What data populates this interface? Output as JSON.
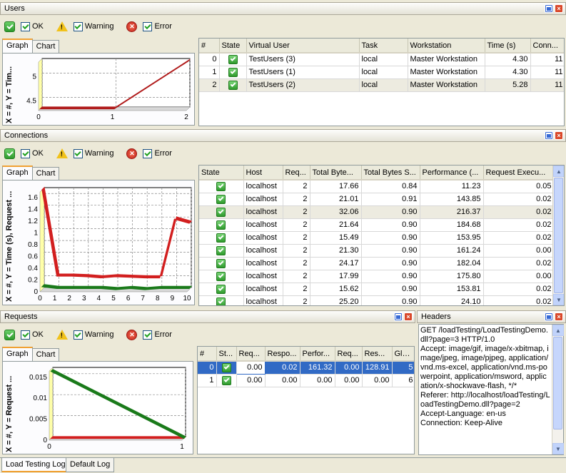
{
  "users": {
    "title": "Users",
    "filters": {
      "ok": "OK",
      "warning": "Warning",
      "error": "Error"
    },
    "tabs": [
      "Graph",
      "Chart"
    ],
    "ylabel": "X = #, Y = Tim...",
    "columns": [
      "#",
      "State",
      "Virtual User",
      "Task",
      "Workstation",
      "Time (s)",
      "Conn..."
    ],
    "rows": [
      [
        "0",
        "ok",
        "TestUsers (3)",
        "local",
        "Master Workstation",
        "4.30",
        "11"
      ],
      [
        "1",
        "ok",
        "TestUsers (1)",
        "local",
        "Master Workstation",
        "4.30",
        "11"
      ],
      [
        "2",
        "ok",
        "TestUsers (2)",
        "local",
        "Master Workstation",
        "5.28",
        "11"
      ]
    ]
  },
  "connections": {
    "title": "Connections",
    "filters": {
      "ok": "OK",
      "warning": "Warning",
      "error": "Error"
    },
    "tabs": [
      "Graph",
      "Chart"
    ],
    "ylabel": "X = #, Y = Time (s), Request ...",
    "columns": [
      "State",
      "Host",
      "Req...",
      "Total Byte...",
      "Total Bytes S...",
      "Performance (...",
      "Request Execu..."
    ],
    "rows": [
      [
        "ok",
        "localhost",
        "2",
        "17.66",
        "0.84",
        "11.23",
        "0.05"
      ],
      [
        "ok",
        "localhost",
        "2",
        "21.01",
        "0.91",
        "143.85",
        "0.02"
      ],
      [
        "ok",
        "localhost",
        "2",
        "32.06",
        "0.90",
        "216.37",
        "0.02"
      ],
      [
        "ok",
        "localhost",
        "2",
        "21.64",
        "0.90",
        "184.68",
        "0.02"
      ],
      [
        "ok",
        "localhost",
        "2",
        "15.49",
        "0.90",
        "153.95",
        "0.02"
      ],
      [
        "ok",
        "localhost",
        "2",
        "21.30",
        "0.90",
        "161.24",
        "0.00"
      ],
      [
        "ok",
        "localhost",
        "2",
        "24.17",
        "0.90",
        "182.04",
        "0.02"
      ],
      [
        "ok",
        "localhost",
        "2",
        "17.99",
        "0.90",
        "175.80",
        "0.00"
      ],
      [
        "ok",
        "localhost",
        "2",
        "15.62",
        "0.90",
        "153.81",
        "0.02"
      ],
      [
        "ok",
        "localhost",
        "2",
        "25.20",
        "0.90",
        "24.10",
        "0.02"
      ]
    ]
  },
  "requests": {
    "title": "Requests",
    "filters": {
      "ok": "OK",
      "warning": "Warning",
      "error": "Error"
    },
    "tabs": [
      "Graph",
      "Chart"
    ],
    "ylabel": "X = #, Y = Request ...",
    "columns": [
      "#",
      "St...",
      "Req...",
      "Respo...",
      "Perfor...",
      "Req...",
      "Res...",
      "Glo..."
    ],
    "rows": [
      [
        "0",
        "ok",
        "0.00",
        "0.02",
        "161.32",
        "0.00",
        "128.91",
        "5"
      ],
      [
        "1",
        "ok",
        "0.00",
        "0.00",
        "0.00",
        "0.00",
        "0.00",
        "6"
      ]
    ]
  },
  "headers": {
    "title": "Headers",
    "text": "GET /loadTesting/LoadTestingDemo.dll?page=3 HTTP/1.0\nAccept: image/gif, image/x-xbitmap, image/jpeg, image/pjpeg, application/vnd.ms-excel, application/vnd.ms-powerpoint, application/msword, application/x-shockwave-flash, */*\nReferer: http://localhost/loadTesting/LoadTestingDemo.dll?page=2\nAccept-Language: en-us\nConnection: Keep-Alive"
  },
  "bottom_tabs": [
    "Load Testing Log",
    "Default Log"
  ],
  "chart_data": [
    {
      "type": "line",
      "x": [
        0,
        1,
        2
      ],
      "xlim": [
        0,
        2
      ],
      "ylim": [
        4.3,
        5.3
      ],
      "yticks": [
        4.5,
        5
      ],
      "xticks": [
        0,
        1,
        2
      ],
      "series": [
        {
          "color": "#b01a1a",
          "values": [
            4.3,
            4.3,
            5.28
          ]
        }
      ]
    },
    {
      "type": "line",
      "x": [
        0,
        1,
        2,
        3,
        4,
        5,
        6,
        7,
        8,
        9,
        10
      ],
      "xlim": [
        0,
        10
      ],
      "ylim": [
        0,
        1.7
      ],
      "yticks": [
        0,
        0.2,
        0.4,
        0.6,
        0.8,
        1,
        1.2,
        1.4,
        1.6
      ],
      "xticks": [
        0,
        1,
        2,
        3,
        4,
        5,
        6,
        7,
        8,
        9,
        10
      ],
      "series": [
        {
          "color": "#d21f1f",
          "values": [
            1.7,
            0.23,
            0.23,
            0.22,
            0.2,
            0.22,
            0.21,
            0.2,
            0.2,
            1.2,
            1.13
          ]
        },
        {
          "color": "#1a7a1a",
          "values": [
            0.05,
            0.02,
            0.02,
            0.02,
            0.02,
            0.0,
            0.02,
            0.0,
            0.02,
            0.02,
            0.02
          ]
        }
      ]
    },
    {
      "type": "line",
      "x": [
        0,
        1
      ],
      "xlim": [
        0,
        1
      ],
      "ylim": [
        0,
        0.0165
      ],
      "yticks": [
        0,
        0.005,
        0.01,
        0.015
      ],
      "xticks": [
        0,
        1
      ],
      "series": [
        {
          "color": "#d21f1f",
          "values": [
            0.0,
            0.0
          ]
        },
        {
          "color": "#1a7a1a",
          "values": [
            0.016,
            0.0
          ]
        }
      ]
    }
  ]
}
